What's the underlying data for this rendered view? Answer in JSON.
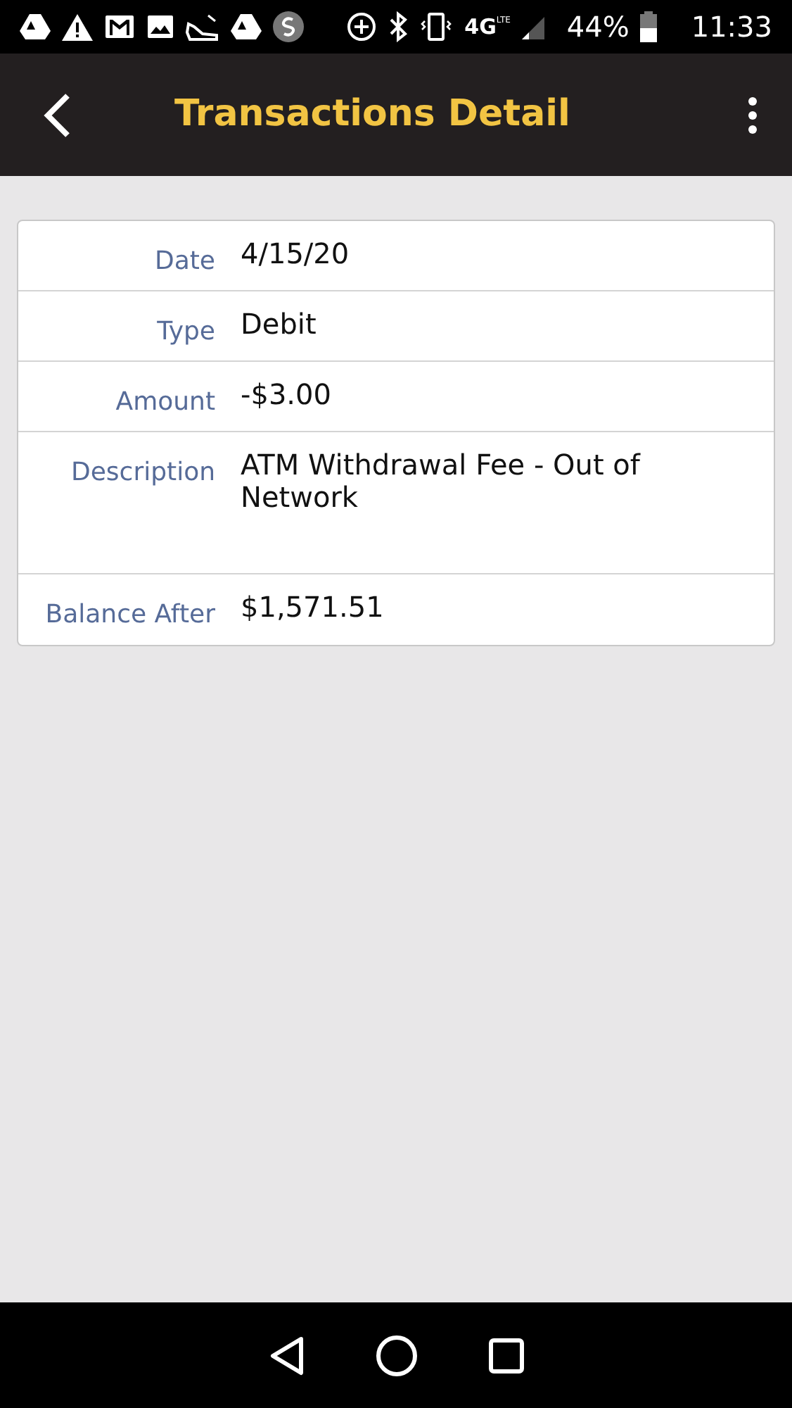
{
  "status_bar": {
    "network": "4G",
    "network_sub": "LTE",
    "battery": "44%",
    "time": "11:33"
  },
  "app_bar": {
    "title": "Transactions Detail"
  },
  "details": [
    {
      "label": "Date",
      "value": "4/15/20"
    },
    {
      "label": "Type",
      "value": "Debit"
    },
    {
      "label": "Amount",
      "value": "-$3.00"
    },
    {
      "label": "Description",
      "value": "ATM Withdrawal Fee - Out of Network",
      "tall": true
    },
    {
      "label": "Balance After",
      "value": "$1,571.51"
    }
  ]
}
